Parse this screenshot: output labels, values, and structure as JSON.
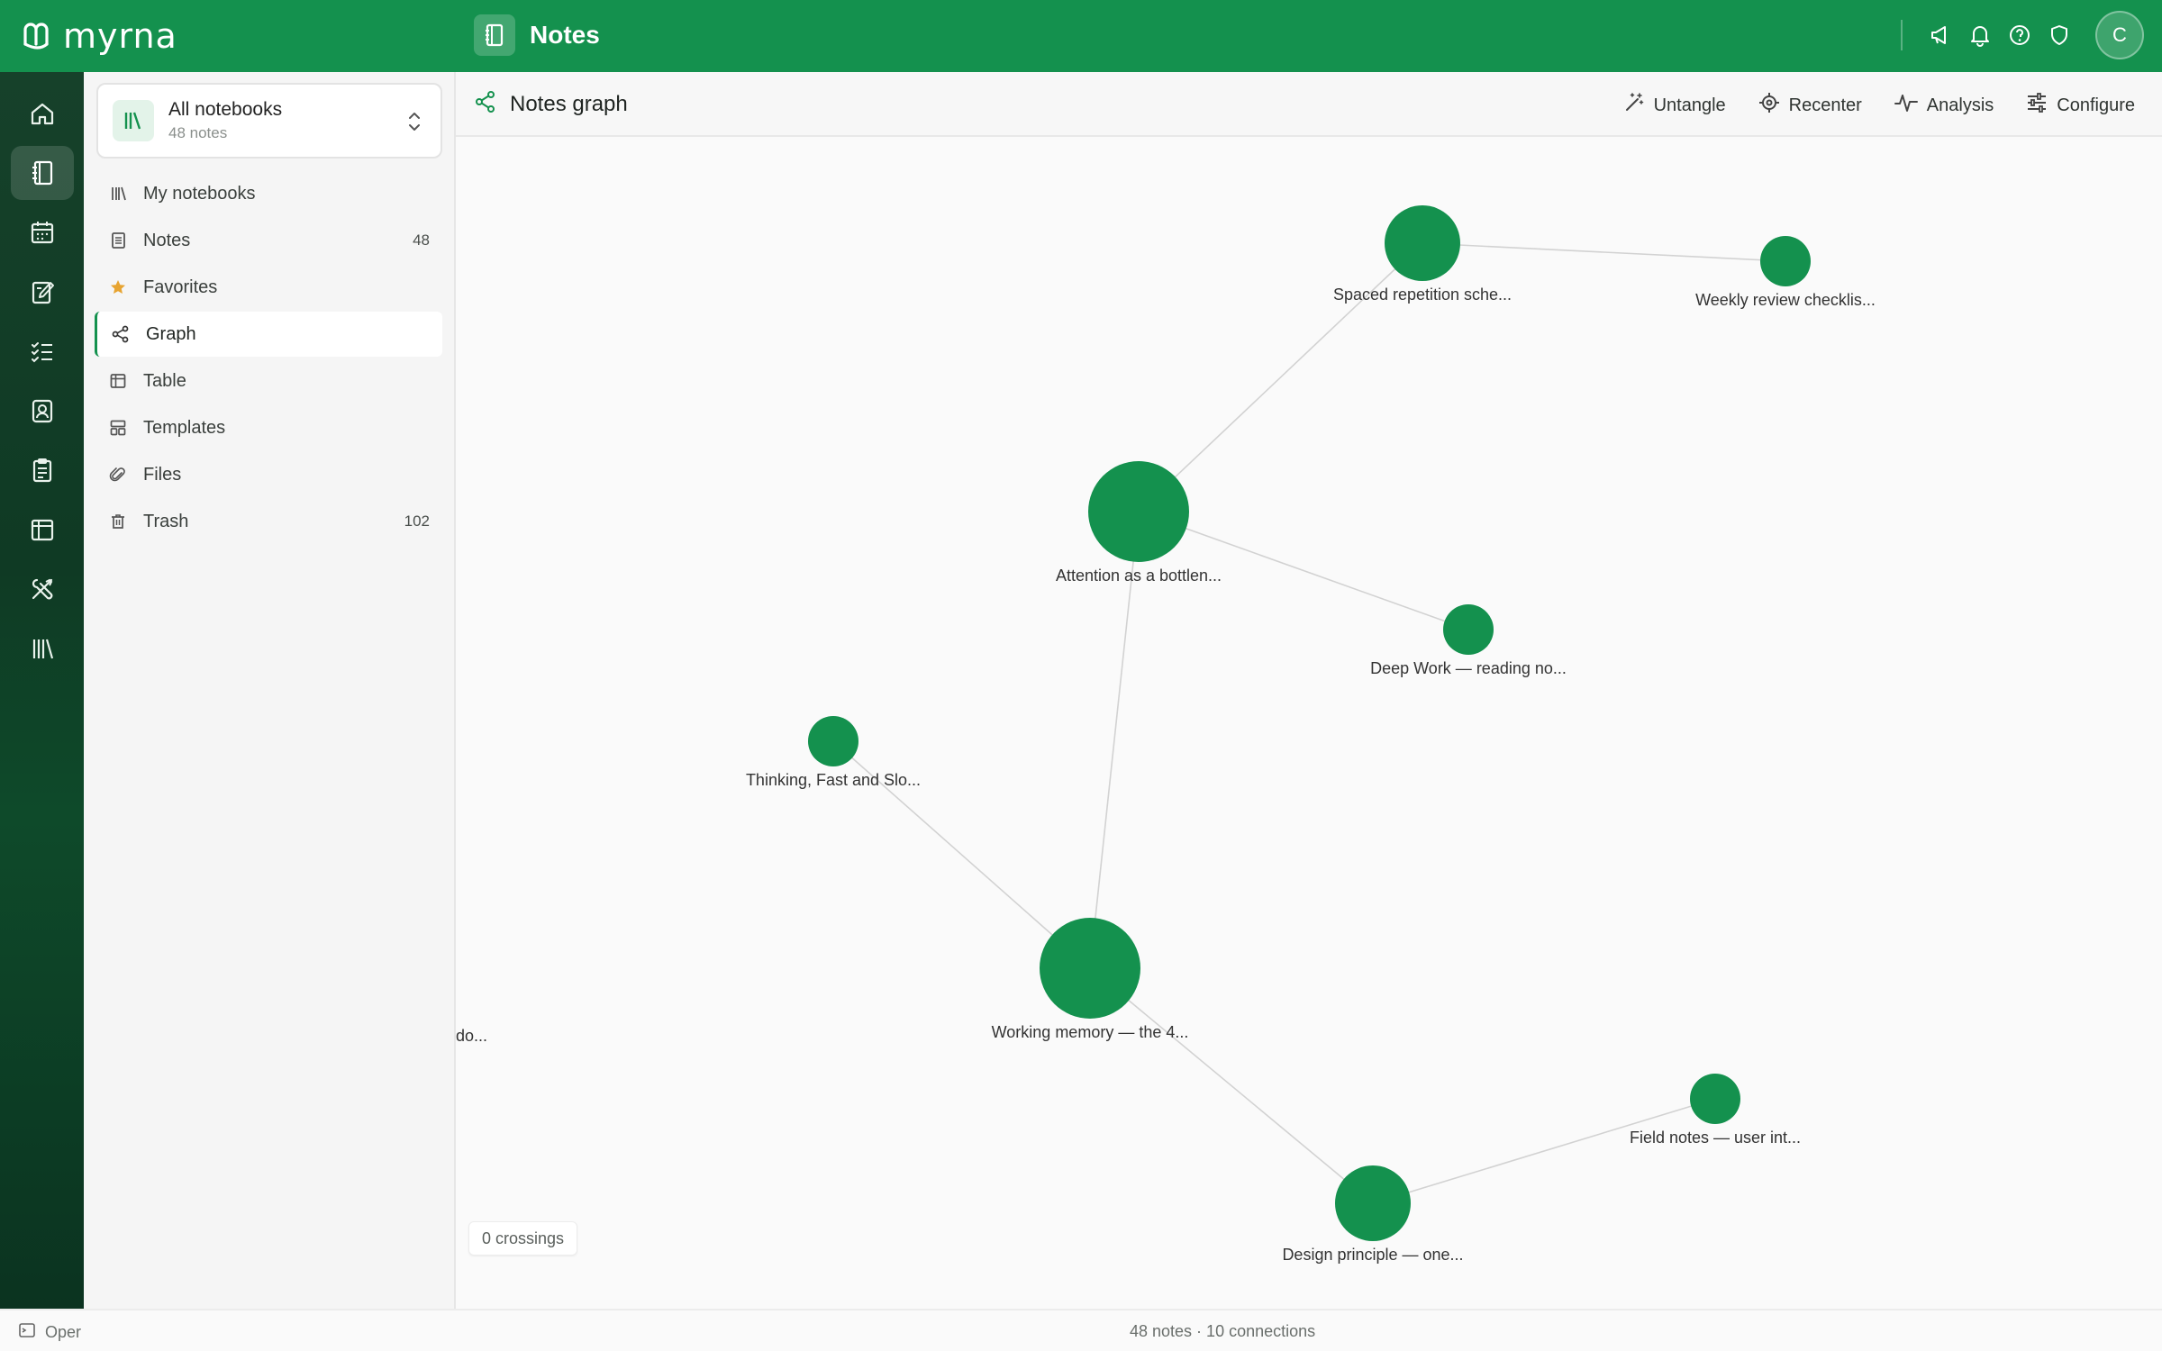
{
  "app": {
    "brand": "myrna",
    "section_title": "Notes",
    "avatar_initial": "C",
    "top_icons": [
      "megaphone-icon",
      "bell-icon",
      "help-icon",
      "shield-icon"
    ]
  },
  "rail": {
    "items": [
      "home",
      "notes",
      "calendar",
      "journal",
      "tasks",
      "contacts",
      "clipboard",
      "table",
      "tools",
      "library"
    ],
    "active": "notes"
  },
  "sidebar": {
    "notebook_selector": {
      "title": "All notebooks",
      "subtitle": "48 notes"
    },
    "items": [
      {
        "label": "My notebooks",
        "icon": "library-icon",
        "count": ""
      },
      {
        "label": "Notes",
        "icon": "note-icon",
        "count": "48"
      },
      {
        "label": "Favorites",
        "icon": "star-icon",
        "count": ""
      },
      {
        "label": "Graph",
        "icon": "share-graph-icon",
        "count": "",
        "active": true
      },
      {
        "label": "Table",
        "icon": "table-icon",
        "count": ""
      },
      {
        "label": "Templates",
        "icon": "templates-icon",
        "count": ""
      },
      {
        "label": "Files",
        "icon": "paperclip-icon",
        "count": ""
      },
      {
        "label": "Trash",
        "icon": "trash-icon",
        "count": "102"
      }
    ]
  },
  "main": {
    "title": "Notes graph",
    "toolbar": {
      "untangle": "Untangle",
      "recenter": "Recenter",
      "analysis": "Analysis",
      "configure": "Configure"
    }
  },
  "graph": {
    "accent": "#14914e",
    "edge_color": "#d2d2d2",
    "nodes": [
      {
        "id": "spaced",
        "label": "Spaced repetition sche..."
      },
      {
        "id": "weekly",
        "label": "Weekly review checklis..."
      },
      {
        "id": "attention",
        "label": "Attention as a bottlen..."
      },
      {
        "id": "deepwork",
        "label": "Deep Work — reading no..."
      },
      {
        "id": "thinking",
        "label": "Thinking, Fast and Slo..."
      },
      {
        "id": "working",
        "label": "Working memory — the 4..."
      },
      {
        "id": "offscreen",
        "label": "do..."
      },
      {
        "id": "field",
        "label": "Field notes — user int..."
      },
      {
        "id": "design",
        "label": "Design principle — one..."
      }
    ],
    "edges": [
      [
        "spaced",
        "weekly"
      ],
      [
        "spaced",
        "attention"
      ],
      [
        "attention",
        "deepwork"
      ],
      [
        "attention",
        "working"
      ],
      [
        "thinking",
        "working"
      ],
      [
        "working",
        "design"
      ],
      [
        "design",
        "field"
      ]
    ],
    "crossings_label": "0 crossings"
  },
  "status": {
    "left_text": "Oper",
    "center_text": "48 notes · 10 connections"
  }
}
